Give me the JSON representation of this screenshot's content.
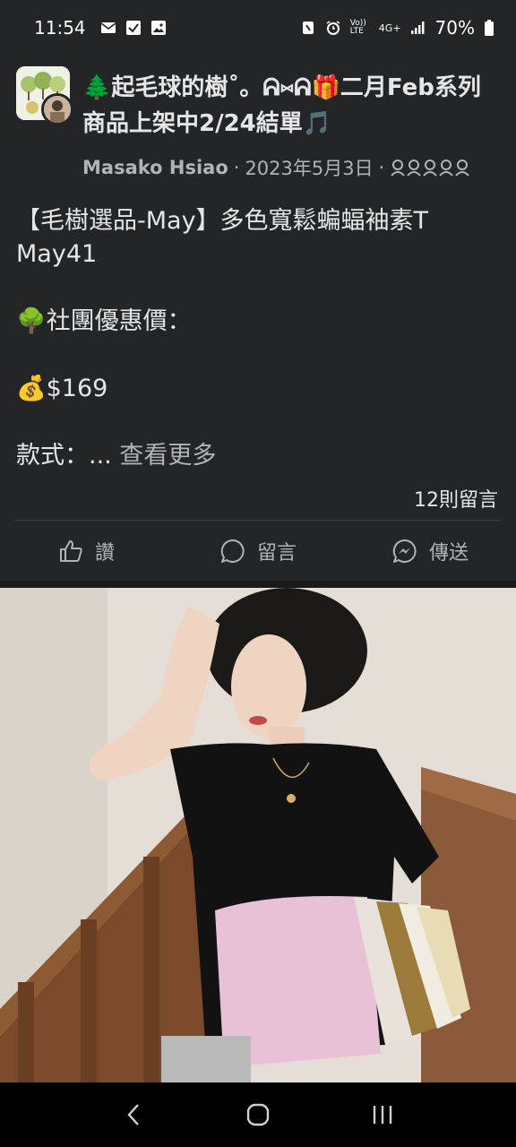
{
  "status_bar": {
    "time": "11:54",
    "network": "4G+",
    "volte": "Vo)) LTE",
    "battery": "70%"
  },
  "post": {
    "group_title": "🌲起毛球的樹˚。ᕱ⑅︎ᕱ🎁二月Feb系列商品上架中2/24結單🎵",
    "author": "Masako Hsiao",
    "separator": "·",
    "date": "2023年5月3日",
    "body": {
      "line1": "【毛樹選品-May】多色寬鬆蝙蝠袖素T",
      "line2": "May41",
      "line3": "🌳社團優惠價：",
      "line4": "💰$169",
      "line5_prefix": "款式：... ",
      "see_more": "查看更多"
    },
    "comments_count": "12則留言"
  },
  "actions": {
    "like": "讚",
    "comment": "留言",
    "share": "傳送"
  },
  "colors": {
    "background": "#242526",
    "text_primary": "#e4e6eb",
    "text_secondary": "#b0b3b8",
    "divider": "#3e4042"
  },
  "icons": {
    "status": [
      "mail-icon",
      "checkbox-icon",
      "gallery-icon",
      "nfc-icon",
      "alarm-icon",
      "signal-icon",
      "battery-icon"
    ],
    "actions": [
      "like-icon",
      "comment-icon",
      "messenger-icon"
    ],
    "nav": [
      "back-icon",
      "home-icon",
      "recents-icon"
    ]
  }
}
